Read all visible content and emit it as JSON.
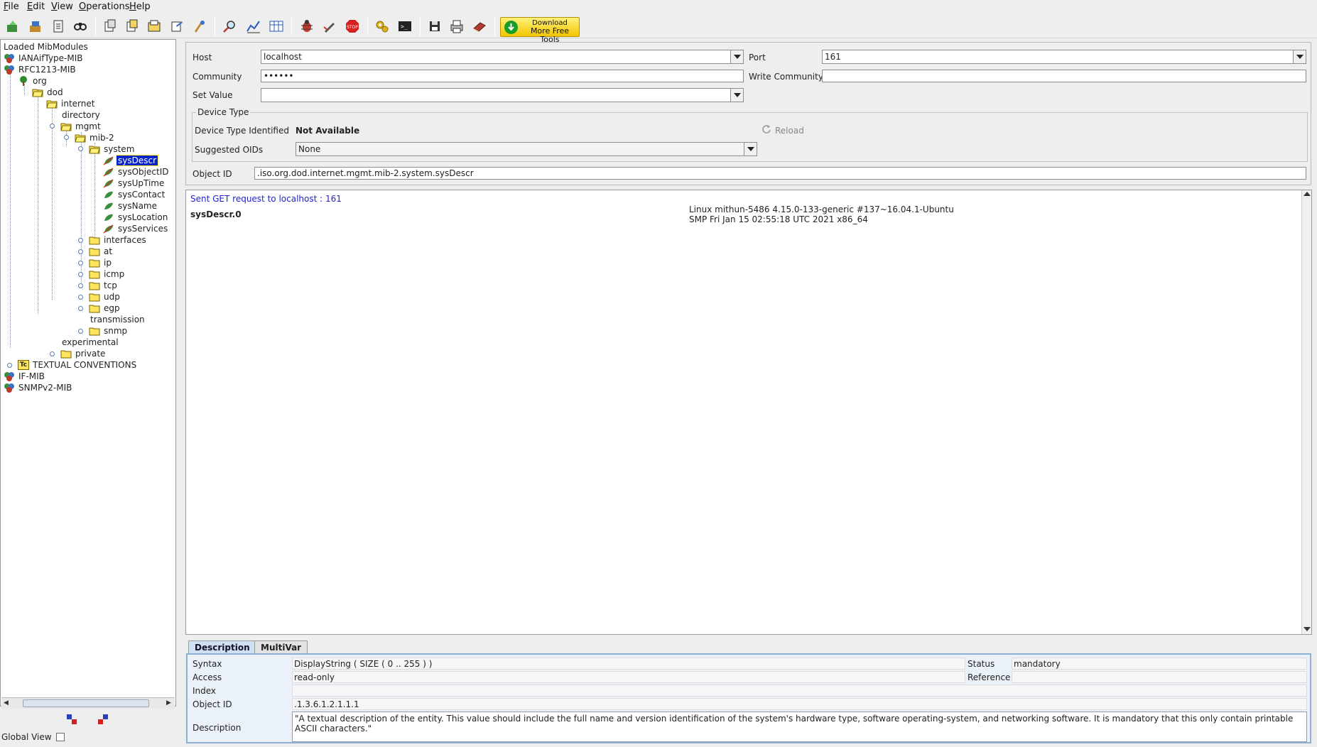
{
  "menu": [
    "File",
    "Edit",
    "View",
    "Operations",
    "Help"
  ],
  "menu_accel": [
    "F",
    "E",
    "V",
    "O",
    "H"
  ],
  "toolbar": {
    "download_line1": "Download",
    "download_line2": "More Free Tools"
  },
  "tree": {
    "title": "Loaded MibModules",
    "nodes": {
      "ianaiftype": "IANAifType-MIB",
      "rfc1213": "RFC1213-MIB",
      "org": "org",
      "dod": "dod",
      "internet": "internet",
      "directory": "directory",
      "mgmt": "mgmt",
      "mib2": "mib-2",
      "system": "system",
      "sysDescr": "sysDescr",
      "sysObjectID": "sysObjectID",
      "sysUpTime": "sysUpTime",
      "sysContact": "sysContact",
      "sysName": "sysName",
      "sysLocation": "sysLocation",
      "sysServices": "sysServices",
      "interfaces": "interfaces",
      "at": "at",
      "ip": "ip",
      "icmp": "icmp",
      "tcp": "tcp",
      "udp": "udp",
      "egp": "egp",
      "transmission": "transmission",
      "snmp": "snmp",
      "experimental": "experimental",
      "private": "private",
      "textual": "TEXTUAL CONVENTIONS",
      "ifmib": "IF-MIB",
      "snmpv2": "SNMPv2-MIB"
    },
    "tc_badge": "Tc",
    "global_view": "Global View"
  },
  "form": {
    "host_label": "Host",
    "host_value": "localhost",
    "port_label": "Port",
    "port_value": "161",
    "community_label": "Community",
    "community_value": "••••••",
    "write_community_label": "Write Community",
    "write_community_value": "",
    "set_value_label": "Set Value",
    "set_value_value": "",
    "device_type_title": "Device Type",
    "device_type_identified_label": "Device Type Identified",
    "device_type_identified_value": "Not Available",
    "reload_label": "Reload",
    "suggested_oids_label": "Suggested OIDs",
    "suggested_oids_value": "None",
    "object_id_label": "Object ID",
    "object_id_value": ".iso.org.dod.internet.mgmt.mib-2.system.sysDescr"
  },
  "result": {
    "sent": "Sent GET request to localhost : 161",
    "name": "sysDescr.0",
    "value_line1": "Linux mithun-5486 4.15.0-133-generic #137~16.04.1-Ubuntu",
    "value_line2": "SMP Fri Jan 15 02:55:18 UTC 2021 x86_64"
  },
  "tabs": [
    "Description",
    "MultiVar"
  ],
  "description": {
    "syntax_label": "Syntax",
    "syntax_value": "DisplayString  ( SIZE ( 0 .. 255  ) )",
    "status_label": "Status",
    "status_value": "mandatory",
    "access_label": "Access",
    "access_value": "read-only",
    "reference_label": "Reference",
    "reference_value": "",
    "index_label": "Index",
    "index_value": "",
    "object_id_label": "Object ID",
    "object_id_value": ".1.3.6.1.2.1.1.1",
    "description_label": "Description",
    "description_value": "\"A textual description of the entity. This value should include the full name and version identification of the system's hardware type, software operating-system, and networking software. It is mandatory that this only contain printable ASCII characters.\""
  },
  "colors": {
    "selection": "#0a24cc",
    "sent_text": "#2222cc",
    "tab_active": "#cfe0f2",
    "download_bg": "#f3c600"
  }
}
